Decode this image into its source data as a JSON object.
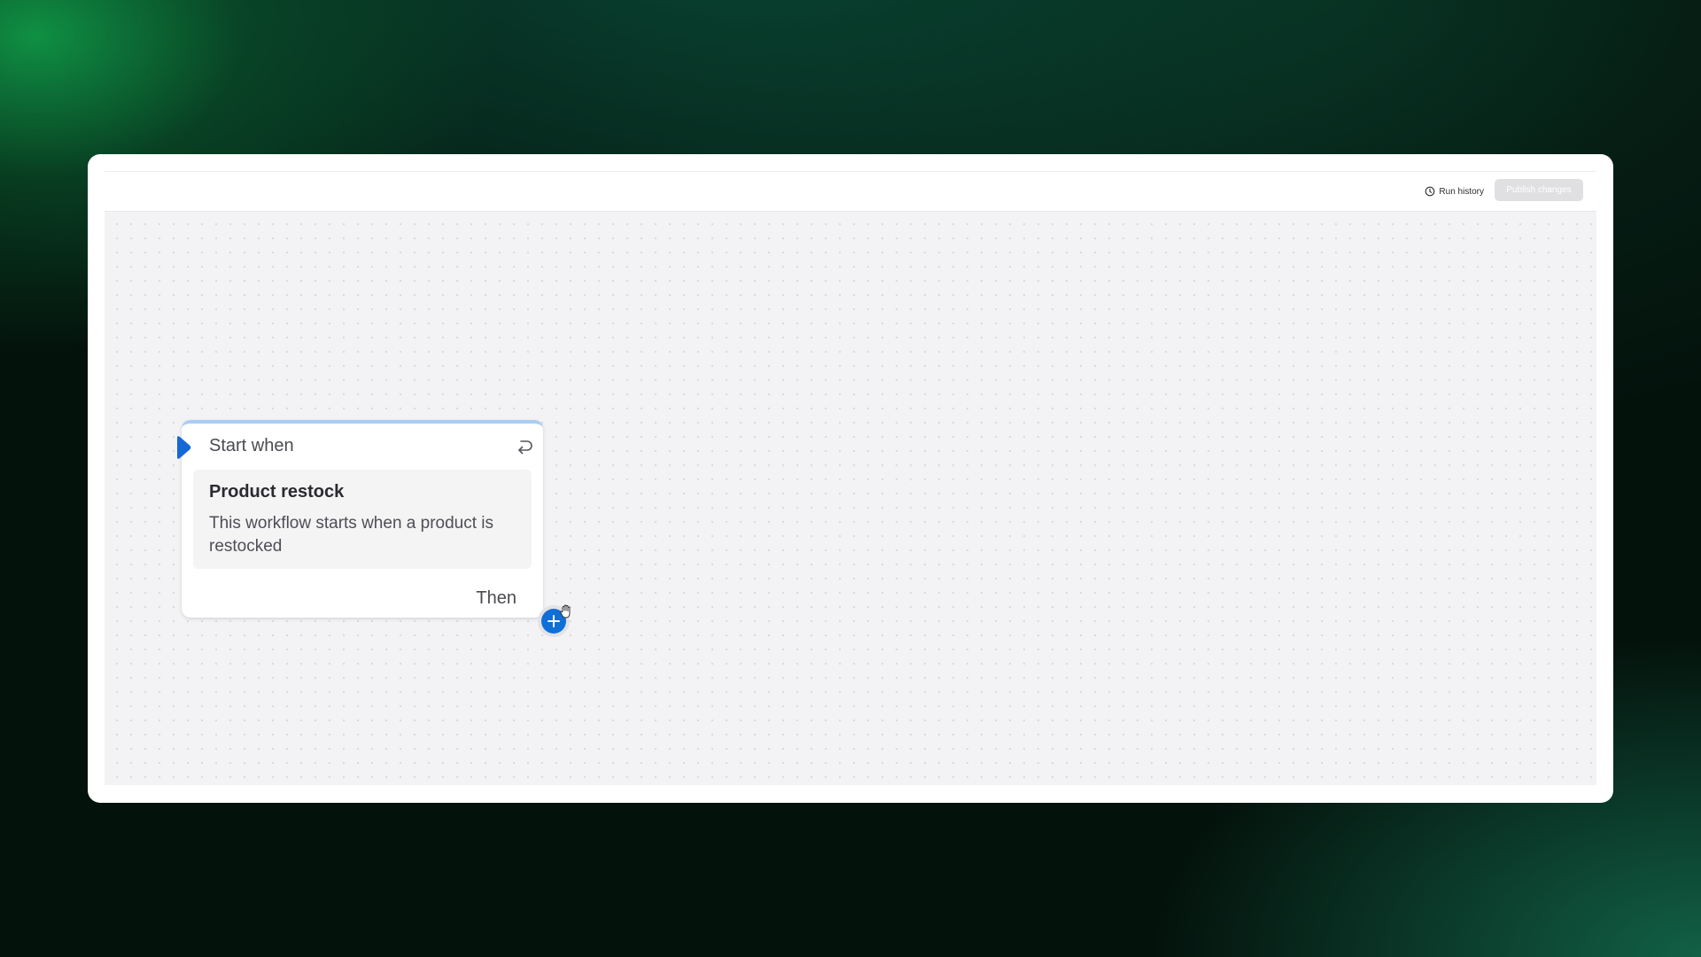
{
  "toolbar": {
    "run_history_label": "Run history",
    "run_history_icon": "clock-icon",
    "publish_label": "Publish changes"
  },
  "trigger": {
    "header_label": "Start when",
    "header_icon": "play-icon",
    "switch_icon": "switch-trigger-icon",
    "title": "Product restock",
    "description": "This workflow starts when a product is restocked",
    "then_label": "Then",
    "add_icon": "plus-icon"
  },
  "colors": {
    "accent": "#0f6fd6",
    "card_top_border": "#a8cdf4",
    "canvas_bg": "#f3f3f5",
    "publish_disabled_bg": "#e0e0e3"
  }
}
